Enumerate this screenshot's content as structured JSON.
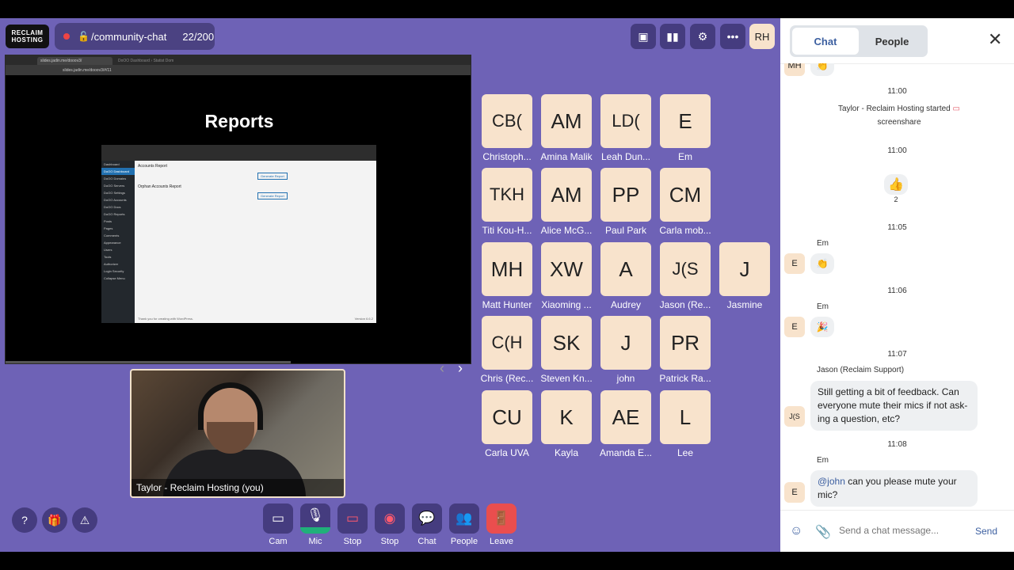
{
  "room": {
    "logo_text": "RECLAIM HOSTING",
    "name": "/community-chat",
    "count": "22/200"
  },
  "me": {
    "initials": "RH"
  },
  "toolbar_icons": [
    "screen-layout-icon",
    "stats-icon",
    "gear-icon",
    "more-icon"
  ],
  "share": {
    "tabs": [
      "slides.jadin.me/dooov3/",
      "DoOO Dashboard › Statist Dom"
    ],
    "url": "slides.jadin.me/dooov3/#/11",
    "slide_title": "Reports",
    "inner_sidebar": [
      "Dashboard",
      "DoOO Dashboard",
      "DoOO Domains",
      "DoOO Servers",
      "DoOO Settings",
      "DoOO Accounts",
      "DoOO Docs",
      "DoOO Reports",
      "Posts",
      "Pages",
      "Comments",
      "Appearance",
      "Users",
      "Tools",
      "Authorizer",
      "Login Security",
      "Collapse Menu"
    ],
    "inner_heading_1": "Accounts Report",
    "inner_heading_2": "Orphan Accounts Report",
    "inner_button": "Generate Report",
    "inner_footer": "Thank you for creating with WordPress.",
    "inner_version": "Version 6.6.2",
    "prev": "‹",
    "next": "›"
  },
  "self_video": {
    "label": "Taylor - Reclaim Hosting (you)"
  },
  "participants": [
    {
      "initials": "CB(",
      "name": "Christoph...",
      "small": true
    },
    {
      "initials": "AM",
      "name": "Amina Malik"
    },
    {
      "initials": "LD(",
      "name": "Leah Dun...",
      "small": true
    },
    {
      "initials": "E",
      "name": "Em"
    },
    {
      "initials": "TKH",
      "name": "Titi Kou-H...",
      "small": true
    },
    {
      "initials": "AM",
      "name": "Alice McG..."
    },
    {
      "initials": "PP",
      "name": "Paul Park"
    },
    {
      "initials": "CM",
      "name": "Carla mob..."
    },
    {
      "initials": "MH",
      "name": "Matt Hunter"
    },
    {
      "initials": "XW",
      "name": "Xiaoming ..."
    },
    {
      "initials": "A",
      "name": "Audrey"
    },
    {
      "initials": "J(S",
      "name": "Jason (Re...",
      "small": true
    },
    {
      "initials": "J",
      "name": "Jasmine"
    },
    {
      "initials": "C(H",
      "name": "Chris (Rec...",
      "small": true
    },
    {
      "initials": "SK",
      "name": "Steven Kn..."
    },
    {
      "initials": "J",
      "name": "john"
    },
    {
      "initials": "PR",
      "name": "Patrick Ra..."
    },
    {
      "initials": "CU",
      "name": "Carla UVA"
    },
    {
      "initials": "K",
      "name": "Kayla"
    },
    {
      "initials": "AE",
      "name": "Amanda E..."
    },
    {
      "initials": "L",
      "name": "Lee"
    }
  ],
  "controls": {
    "help": "?",
    "gift": "🎁",
    "warn": "⚠",
    "cam": "Cam",
    "mic": "Mic",
    "stop_share": "Stop",
    "stop_rec": "Stop",
    "chat": "Chat",
    "people": "People",
    "leave": "Leave"
  },
  "chat": {
    "tab_chat": "Chat",
    "tab_people": "People",
    "close": "✕",
    "partial_avatar": "MH",
    "partial_emoji": "👏",
    "t1": "11:00",
    "sys_line1": "Taylor - Reclaim Hosting started",
    "sys_line2": "screenshare",
    "t2": "11:00",
    "reaction": "👍",
    "reaction_count": "2",
    "t3": "11:05",
    "em1_name": "Em",
    "em1_avatar": "E",
    "em1_emoji": "👏",
    "t4": "11:06",
    "em2_name": "Em",
    "em2_avatar": "E",
    "em2_emoji": "🎉",
    "t5": "11:07",
    "jason_name": "Jason (Reclaim Support)",
    "jason_avatar": "J(S",
    "jason_msg": "Still getting a bit of feedback. Can everyone mute their mics if not ask-ing a question, etc?",
    "t6": "11:08",
    "em3_name": "Em",
    "em3_avatar": "E",
    "em3_mention": "@john",
    "em3_msg": " can you please mute your mic?",
    "placeholder": "Send a chat message...",
    "send": "Send"
  },
  "colors": {
    "stage": "#6e62b6",
    "tile": "#f8e3cc",
    "accent": "#3c5fa0",
    "mic_on": "#20b07a",
    "leave": "#ea4e4e"
  }
}
